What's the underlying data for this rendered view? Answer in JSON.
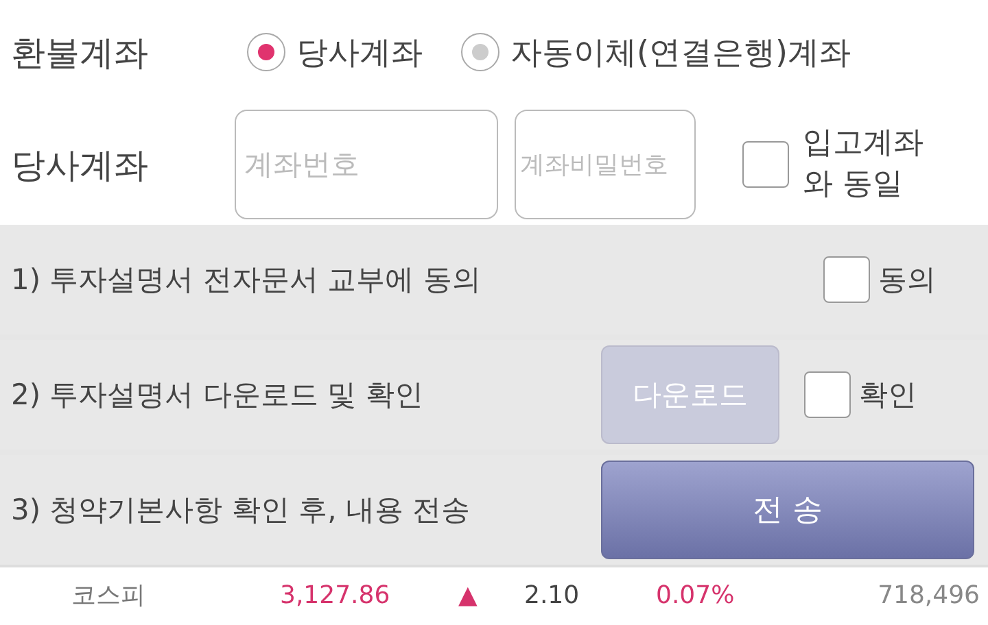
{
  "refund_account": {
    "label": "환불계좌",
    "options": [
      {
        "label": "당사계좌",
        "selected": true
      },
      {
        "label": "자동이체(연결은행)계좌",
        "selected": false
      }
    ]
  },
  "company_account": {
    "label": "당사계좌",
    "fields": [
      {
        "placeholder": "계좌번호"
      },
      {
        "placeholder": "계좌비밀번호"
      }
    ],
    "same_as_deposit": {
      "label": "입고계좌 와 동일",
      "checked": false
    }
  },
  "steps": [
    {
      "kind": "check",
      "label": "1) 투자설명서 전자문서 교부에 동의",
      "check_label": "동의",
      "checked": false
    },
    {
      "kind": "download",
      "label": "2) 투자설명서 다운로드 및 확인",
      "button": "다운로드",
      "disabled": true,
      "check_label": "확인",
      "checked": false
    },
    {
      "kind": "send",
      "label": "3) 청약기본사항 확인 후, 내용 전송",
      "button": "전 송"
    }
  ],
  "ticker": {
    "name": "코스피",
    "value": "3,127.86",
    "arrow": "▲",
    "change": "2.10",
    "percent": "0.07%",
    "volume": "718,496"
  }
}
